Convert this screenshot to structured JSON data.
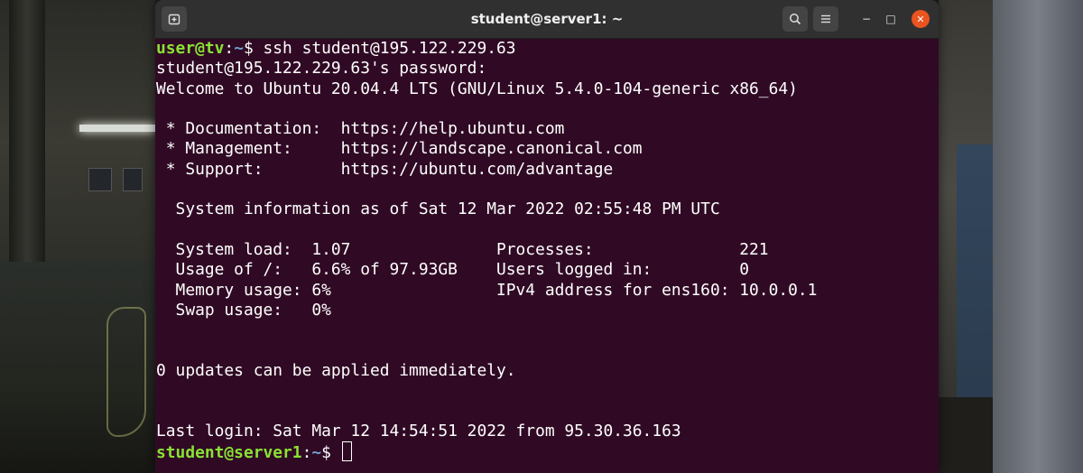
{
  "window": {
    "title": "student@server1: ~",
    "new_tab_icon": "new-tab-icon",
    "search_icon": "search-icon",
    "menu_icon": "hamburger-menu-icon",
    "minimize_label": "−",
    "maximize_label": "□",
    "close_label": "✕",
    "close_color": "#e95420",
    "terminal_bg": "#300a24",
    "prompt_user_color": "#8ae234",
    "prompt_path_color": "#729fcf"
  },
  "terminal": {
    "prompt1": {
      "userhost": "user@tv",
      "sep": ":",
      "path": "~",
      "sym": "$ ",
      "command": "ssh student@195.122.229.63"
    },
    "lines": {
      "l2": "student@195.122.229.63's password:",
      "l3": "Welcome to Ubuntu 20.04.4 LTS (GNU/Linux 5.4.0-104-generic x86_64)",
      "doc": " * Documentation:  https://help.ubuntu.com",
      "mgmt": " * Management:     https://landscape.canonical.com",
      "support": " * Support:        https://ubuntu.com/advantage",
      "sysinfo": "  System information as of Sat 12 Mar 2022 02:55:48 PM UTC",
      "load": "  System load:  1.07               Processes:               221",
      "usage": "  Usage of /:   6.6% of 97.93GB    Users logged in:         0",
      "memory": "  Memory usage: 6%                 IPv4 address for ens160: 10.0.0.1",
      "swap": "  Swap usage:   0%",
      "updates": "0 updates can be applied immediately.",
      "lastlogin": "Last login: Sat Mar 12 14:54:51 2022 from 95.30.36.163"
    },
    "prompt2": {
      "userhost": "student@server1",
      "sep": ":",
      "path": "~",
      "sym": "$ "
    }
  }
}
